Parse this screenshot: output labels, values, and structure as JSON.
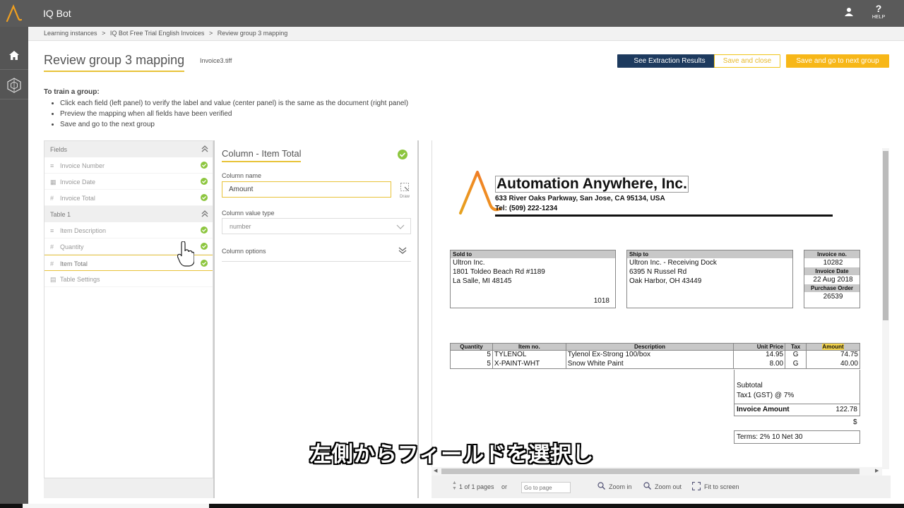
{
  "app": {
    "title": "IQ Bot",
    "help_label": "HELP",
    "help_glyph": "?"
  },
  "breadcrumb": [
    "Learning instances",
    ">",
    "IQ Bot Free Trial English Invoices",
    ">",
    "Review group 3 mapping"
  ],
  "page": {
    "title": "Review group 3 mapping",
    "filename": "Invoice3.tiff"
  },
  "actions": {
    "see_results": "See Extraction Results",
    "save_close": "Save and close",
    "save_next": "Save and go to next group"
  },
  "instructions": {
    "title": "To train a group:",
    "steps": [
      "Click each field (left panel) to verify the label and value (center panel) is the same as the document (right panel)",
      "Preview the mapping when all fields have been verified",
      "Save and go to the next group"
    ]
  },
  "fields_panel": {
    "fields_header": "Fields",
    "fields": [
      {
        "label": "Invoice Number",
        "icon": "text-lines-icon",
        "glyph": "≡",
        "checked": true
      },
      {
        "label": "Invoice Date",
        "icon": "calendar-icon",
        "glyph": "▦",
        "checked": true
      },
      {
        "label": "Invoice Total",
        "icon": "hash-icon",
        "glyph": "#",
        "checked": true
      }
    ],
    "table_header": "Table 1",
    "table_fields": [
      {
        "label": "Item Description",
        "icon": "text-lines-icon",
        "glyph": "≡",
        "checked": true
      },
      {
        "label": "Quantity",
        "icon": "hash-icon",
        "glyph": "#",
        "checked": true
      },
      {
        "label": "Item Total",
        "icon": "hash-icon",
        "glyph": "#",
        "checked": true,
        "selected": true
      },
      {
        "label": "Table Settings",
        "icon": "table-icon",
        "glyph": "▤",
        "checked": false
      }
    ]
  },
  "detail": {
    "title": "Column - Item Total",
    "column_name_label": "Column name",
    "column_name_value": "Amount",
    "draw_label": "Draw",
    "value_type_label": "Column value type",
    "value_type": "number",
    "column_options": "Column options"
  },
  "viewer": {
    "pages": "1 of 1 pages",
    "or": "or",
    "goto_placeholder": "Go to page",
    "zoom_in": "Zoom in",
    "zoom_out": "Zoom out",
    "fit": "Fit to screen"
  },
  "invoice": {
    "company": "Automation Anywhere, Inc.",
    "address": "633 River Oaks Parkway, San Jose, CA 95134, USA",
    "phone": "Tel: (509) 222-1234",
    "sold_to": {
      "head": "Sold to",
      "lines": [
        "Ultron Inc.",
        "1801 Toldeo Beach Rd #1189",
        "La Salle, MI 48145"
      ],
      "code": "1018"
    },
    "ship_to": {
      "head": "Ship to",
      "lines": [
        "Ultron Inc. - Receiving Dock",
        "6395 N Russel Rd",
        "Oak Harbor, OH 43449"
      ]
    },
    "meta": {
      "invoice_no_label": "Invoice no.",
      "invoice_no": "10282",
      "date_label": "Invoice Date",
      "date": "22 Aug 2018",
      "po_label": "Purchase Order",
      "po": "26539"
    },
    "table_headers": [
      "Quantity",
      "Item no.",
      "Description",
      "Unit Price",
      "Tax",
      "Amount"
    ],
    "rows": [
      [
        "5",
        "TYLENOL",
        "Tylenol Ex-Strong 100/box",
        "14.95",
        "G",
        "74.75"
      ],
      [
        "5",
        "X-PAINT-WHT",
        "Snow White Paint",
        "8.00",
        "G",
        "40.00"
      ]
    ],
    "subtotal": "Subtotal",
    "tax": "Tax1 (GST) @ 7%",
    "invoice_amount_label": "Invoice Amount",
    "invoice_amount": "122.78",
    "currency": "$",
    "terms": "Terms:  2% 10   Net 30"
  },
  "subtitle": "左側からフィールドを選択し",
  "colors": {
    "accent": "#e8c33a",
    "primary": "#1d3a5e",
    "yellow": "#f7b718",
    "check": "#8dc63f"
  }
}
